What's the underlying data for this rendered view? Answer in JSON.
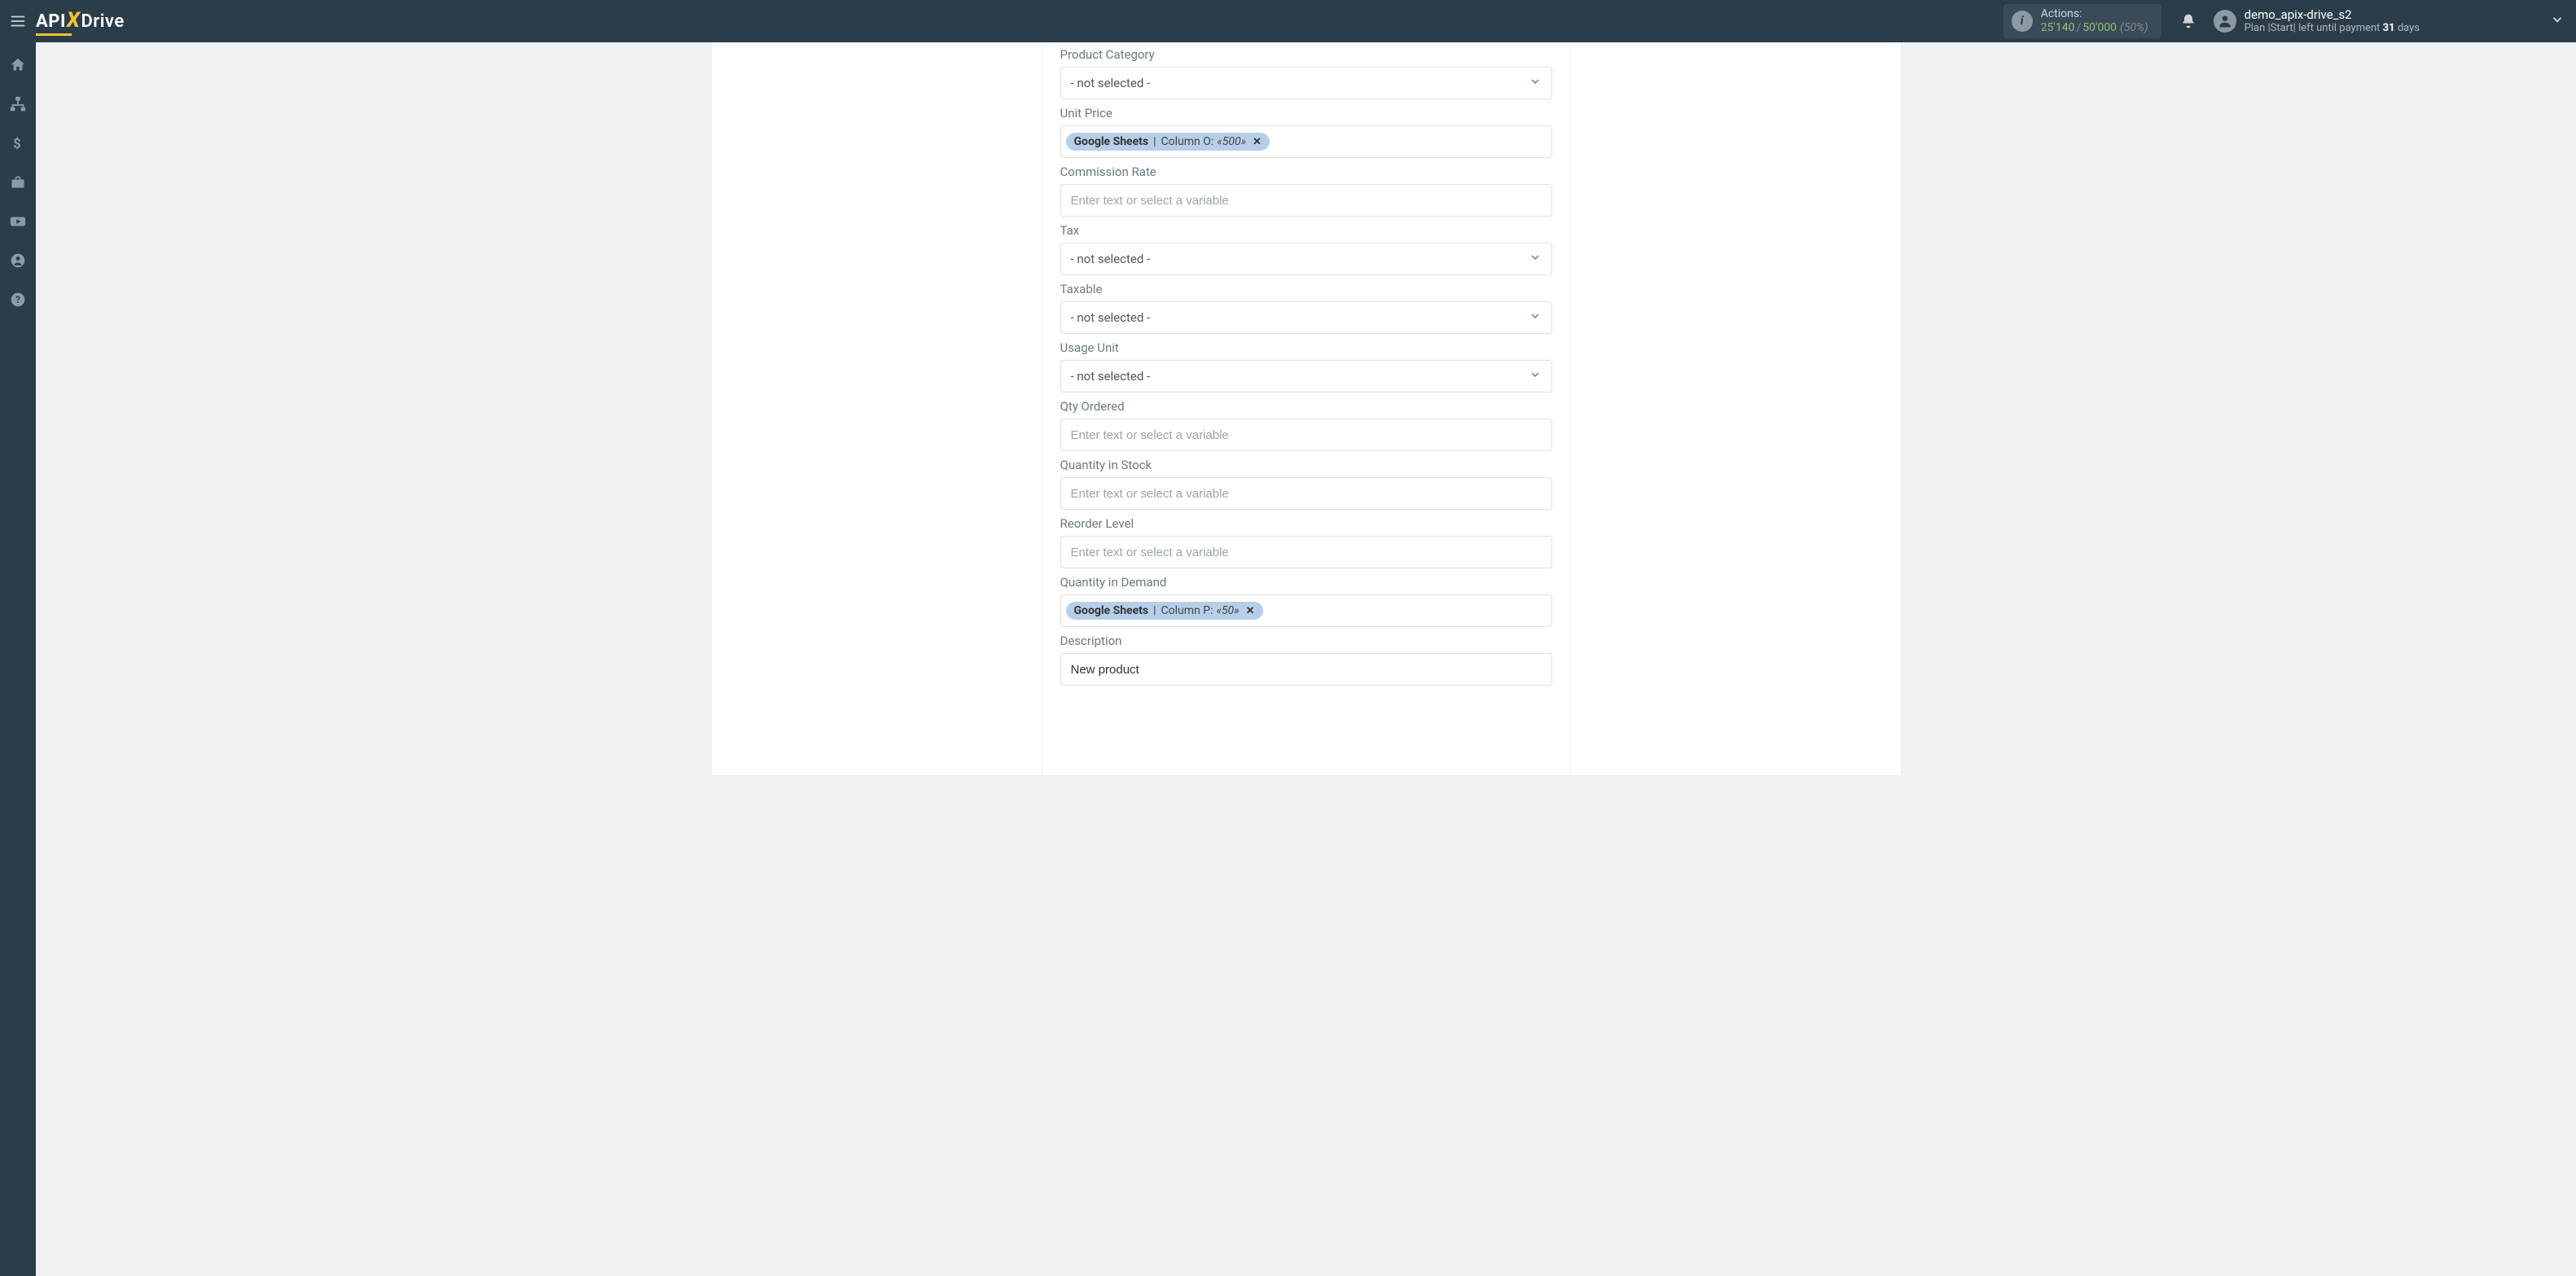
{
  "header": {
    "logo": {
      "api": "API",
      "x": "X",
      "drive": "Drive"
    },
    "actions": {
      "label": "Actions:",
      "used": "25'140",
      "sep": "/",
      "total": "50'000",
      "pct": "(50%)"
    },
    "user": {
      "name": "demo_apix-drive_s2",
      "plan_prefix": "Plan |Start| left until payment ",
      "days_num": "31",
      "days_suffix": " days"
    }
  },
  "form": {
    "not_selected": "- not selected -",
    "placeholder": "Enter text or select a variable",
    "fields": {
      "product_category": {
        "label": "Product Category"
      },
      "unit_price": {
        "label": "Unit Price",
        "token": {
          "source": "Google Sheets",
          "column": "Column O:",
          "value": "«500»"
        }
      },
      "commission_rate": {
        "label": "Commission Rate"
      },
      "tax": {
        "label": "Tax"
      },
      "taxable": {
        "label": "Taxable"
      },
      "usage_unit": {
        "label": "Usage Unit"
      },
      "qty_ordered": {
        "label": "Qty Ordered"
      },
      "quantity_in_stock": {
        "label": "Quantity in Stock"
      },
      "reorder_level": {
        "label": "Reorder Level"
      },
      "quantity_in_demand": {
        "label": "Quantity in Demand",
        "token": {
          "source": "Google Sheets",
          "column": "Column P:",
          "value": "«50»"
        }
      },
      "description": {
        "label": "Description",
        "value": "New product"
      }
    }
  }
}
